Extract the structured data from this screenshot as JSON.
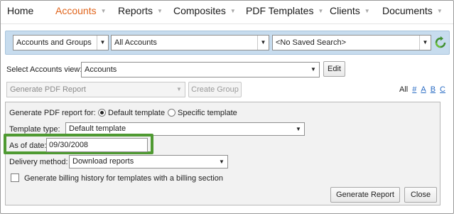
{
  "nav": {
    "items": [
      {
        "label": "Home"
      },
      {
        "label": "Accounts"
      },
      {
        "label": "Reports"
      },
      {
        "label": "Composites"
      },
      {
        "label": "PDF Templates"
      },
      {
        "label": "Clients"
      },
      {
        "label": "Documents"
      }
    ],
    "active": "Accounts",
    "active_color": "#e0641b"
  },
  "search": {
    "group_select": "Accounts and Groups",
    "accounts_select": "All Accounts",
    "saved_search_select": "<No Saved Search>",
    "band_color": "#c7dcee",
    "refresh_icon": "refresh-icon"
  },
  "view": {
    "label": "Select Accounts view:",
    "value": "Accounts",
    "edit_label": "Edit"
  },
  "actions": {
    "action_select": "Generate PDF Report",
    "create_group_label": "Create Group"
  },
  "alpha_filter": {
    "all": "All",
    "links": [
      "#",
      "A",
      "B",
      "C"
    ]
  },
  "pdf_panel": {
    "generate_for_label": "Generate PDF report for:",
    "default_template_option": "Default template",
    "specific_template_option": "Specific template",
    "selected_option": "Default template",
    "template_type_label": "Template type:",
    "template_type_value": "Default template",
    "as_of_label": "As of date:",
    "as_of_value": "09/30/2008",
    "delivery_label": "Delivery method:",
    "delivery_value": "Download reports",
    "billing_checkbox_label": "Generate billing history for templates with a billing section",
    "billing_checked": false,
    "generate_button": "Generate Report",
    "close_button": "Close",
    "highlight_color": "#4f9a32"
  }
}
